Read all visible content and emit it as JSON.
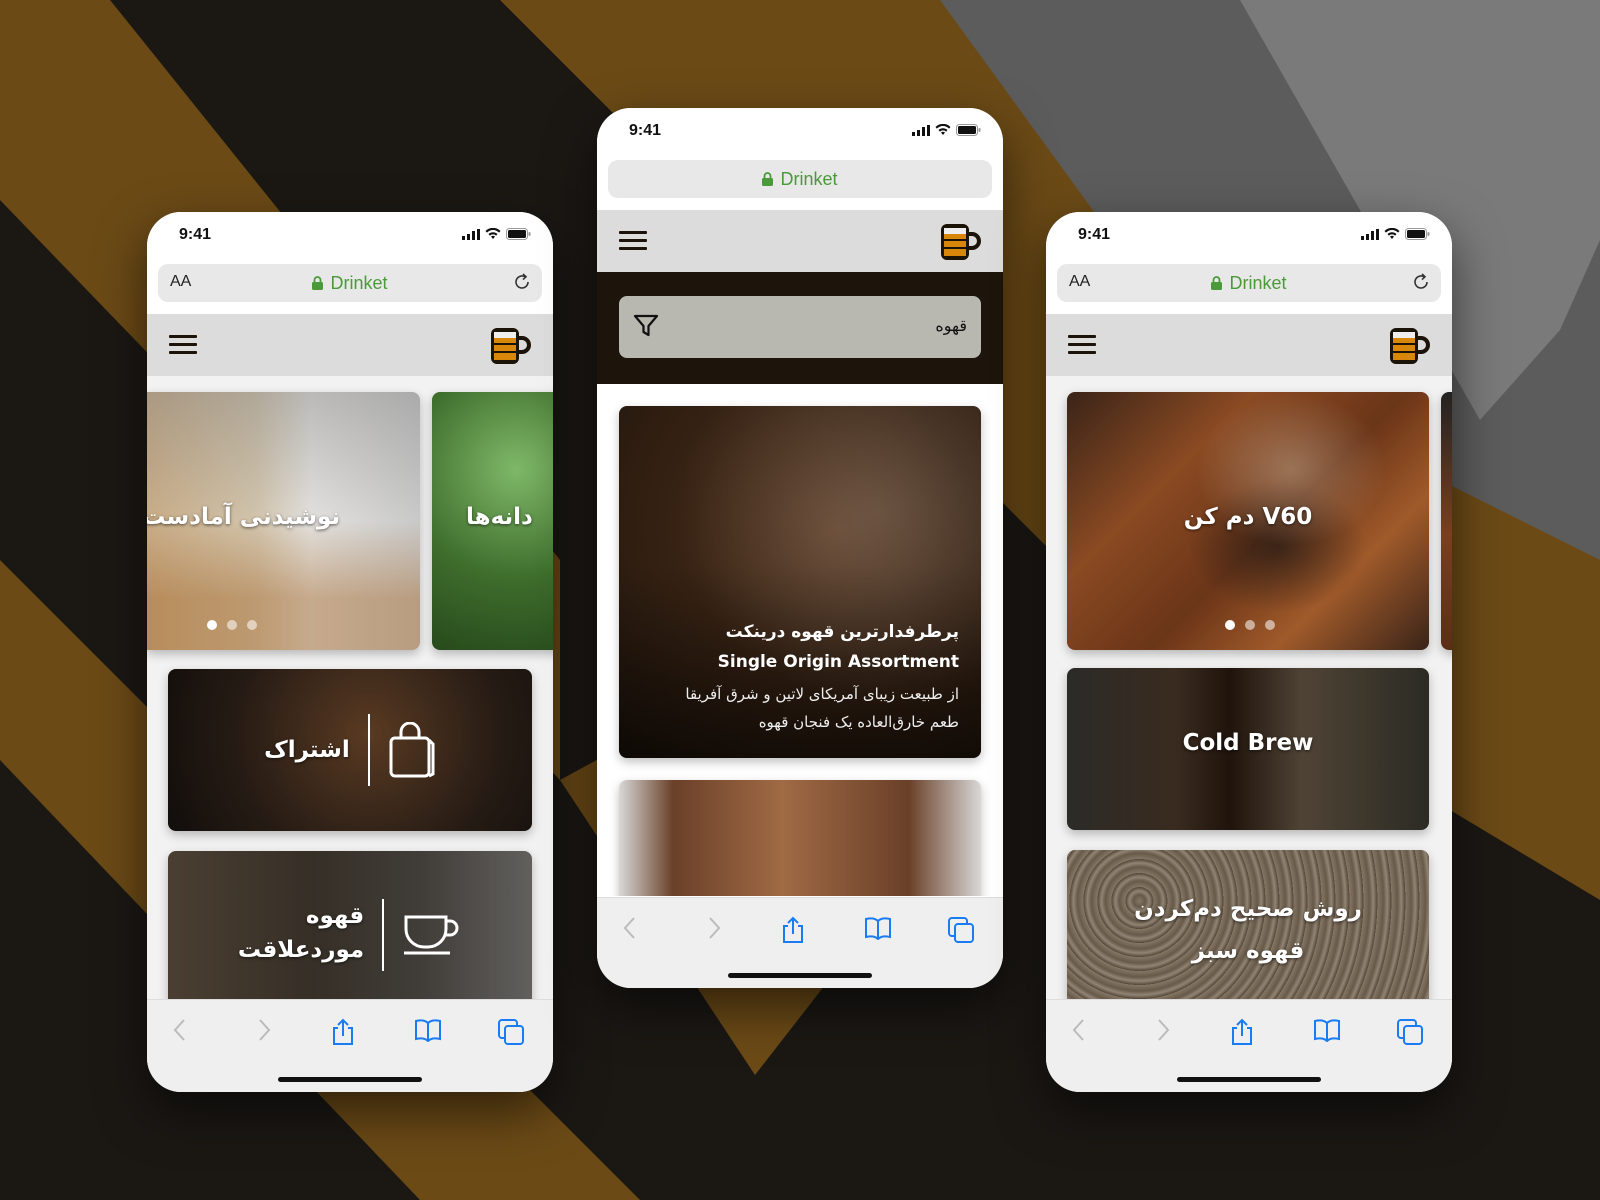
{
  "colors": {
    "accent_green": "#4a9a3a",
    "ios_blue": "#1a7cf5",
    "header_gray": "#dcdcdc",
    "dark_brown": "#1d150c",
    "brand_amber": "#d9870a",
    "bg_brown": "#6b4a16"
  },
  "phones": [
    {
      "status": {
        "time": "9:41"
      },
      "browser": {
        "text_size_label": "AA",
        "site": "Drinket"
      },
      "carousel": {
        "slides": [
          {
            "title": "نوشیدنی آمادست"
          },
          {
            "title": "دانه‌ها"
          }
        ],
        "active_dot": 0,
        "dot_count": 3
      },
      "tiles": [
        {
          "label": "اشتراک",
          "icon": "shopping-bag-icon"
        },
        {
          "label_line1": "قهوه",
          "label_line2": "موردعلاقت",
          "icon": "coffee-cup-icon"
        }
      ]
    },
    {
      "status": {
        "time": "9:41"
      },
      "browser": {
        "site": "Drinket"
      },
      "search": {
        "value": "قهوه",
        "icon": "filter-icon"
      },
      "featured": {
        "title_fa": "پرطرفدارترین قهوه درینکت",
        "title_en": "Single Origin Assortment",
        "desc_line1": "از طبیعت زیبای آمریکای لاتین و شرق آفریقا",
        "desc_line2": "طعم خارق‌العاده یک فنجان قهوه"
      }
    },
    {
      "status": {
        "time": "9:41"
      },
      "browser": {
        "text_size_label": "AA",
        "site": "Drinket"
      },
      "carousel": {
        "slides": [
          {
            "title": "V60 دم کن"
          }
        ],
        "active_dot": 0,
        "dot_count": 3
      },
      "cards": [
        {
          "title": "Cold Brew"
        },
        {
          "title_line1": "روش صحیح دم‌کردن",
          "title_line2": "قهوه سبز"
        }
      ]
    }
  ],
  "toolbar_icons": [
    "back-icon",
    "forward-icon",
    "share-icon",
    "bookmarks-icon",
    "tabs-icon"
  ]
}
